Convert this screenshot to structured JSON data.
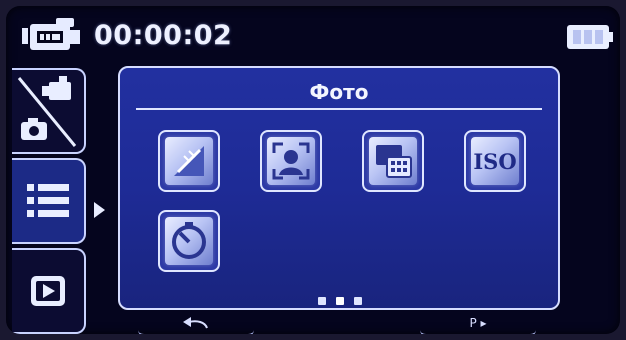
{
  "status_bar": {
    "mode_icon": "video-camera-icon",
    "timecode": "00:00:02",
    "battery_icon": "battery-full-icon"
  },
  "sidebar": {
    "tabs": [
      {
        "icon": "camera-video-mode-icon",
        "active": false
      },
      {
        "icon": "menu-list-icon",
        "active": true
      },
      {
        "icon": "playback-icon",
        "active": false
      }
    ]
  },
  "menu": {
    "title": "Фото",
    "items": [
      {
        "icon": "resolution-icon"
      },
      {
        "icon": "face-detect-icon"
      },
      {
        "icon": "frame-size-icon",
        "text": ""
      },
      {
        "icon": "iso-icon",
        "text": "ISO"
      },
      {
        "icon": "self-timer-icon"
      }
    ],
    "page_indicator": {
      "total": 3,
      "current": 1
    }
  },
  "soft_keys": {
    "left": {
      "icon": "return-arrow-icon"
    },
    "right": {
      "icon": "page-next-icon",
      "text": "P ▸"
    }
  },
  "colors": {
    "panel_blue": "#1e2b96",
    "outline": "#d6ddff",
    "background": "#05051e"
  }
}
